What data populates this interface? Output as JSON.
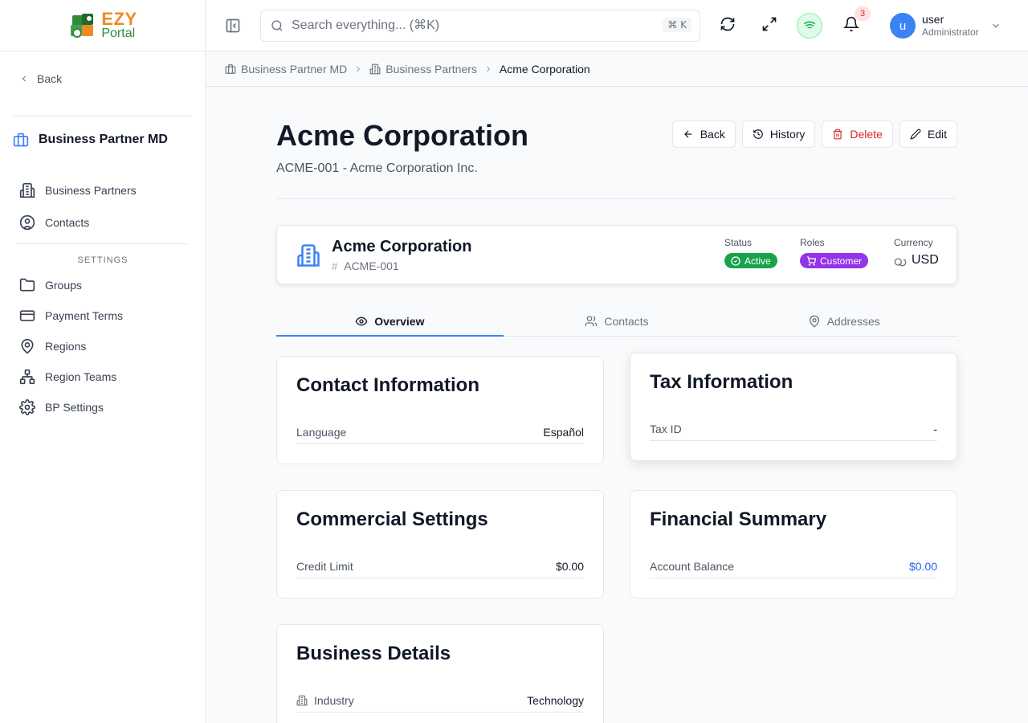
{
  "app": {
    "logo_line1": "EZY",
    "logo_line2": "Portal"
  },
  "sidebar": {
    "back_label": "Back",
    "module_title": "Business Partner MD",
    "items": [
      {
        "label": "Business Partners",
        "icon": "building-icon"
      },
      {
        "label": "Contacts",
        "icon": "user-circle-icon"
      }
    ],
    "settings_label": "SETTINGS",
    "settings_items": [
      {
        "label": "Groups",
        "icon": "folder-icon"
      },
      {
        "label": "Payment Terms",
        "icon": "credit-card-icon"
      },
      {
        "label": "Regions",
        "icon": "map-pin-icon"
      },
      {
        "label": "Region Teams",
        "icon": "network-icon"
      },
      {
        "label": "BP Settings",
        "icon": "gear-icon"
      }
    ]
  },
  "header": {
    "search_placeholder": "Search everything... (⌘K)",
    "search_shortcut": "⌘ K",
    "notification_count": "3",
    "user_name": "user",
    "user_role": "Administrator",
    "avatar_letter": "u"
  },
  "breadcrumb": {
    "items": [
      "Business Partner MD",
      "Business Partners"
    ],
    "current": "Acme Corporation"
  },
  "page": {
    "title": "Acme Corporation",
    "subtitle": "ACME-001 - Acme Corporation Inc.",
    "actions": {
      "back": "Back",
      "history": "History",
      "delete": "Delete",
      "edit": "Edit"
    }
  },
  "summary": {
    "name": "Acme Corporation",
    "code": "ACME-001",
    "status_label": "Status",
    "status_value": "Active",
    "roles_label": "Roles",
    "role_value": "Customer",
    "currency_label": "Currency",
    "currency_value": "USD",
    "colors": {
      "active": "#16a34a",
      "customer": "#9333ea"
    }
  },
  "tabs": [
    {
      "label": "Overview",
      "active": true
    },
    {
      "label": "Contacts",
      "active": false
    },
    {
      "label": "Addresses",
      "active": false
    }
  ],
  "cards": {
    "contact": {
      "title": "Contact Information",
      "label": "Language",
      "value": "Español"
    },
    "tax": {
      "title": "Tax Information",
      "label": "Tax ID",
      "value": "-"
    },
    "commercial": {
      "title": "Commercial Settings",
      "label": "Credit Limit",
      "value": "$0.00"
    },
    "financial": {
      "title": "Financial Summary",
      "label": "Account Balance",
      "value": "$0.00"
    },
    "business": {
      "title": "Business Details",
      "label": "Industry",
      "value": "Technology"
    }
  }
}
